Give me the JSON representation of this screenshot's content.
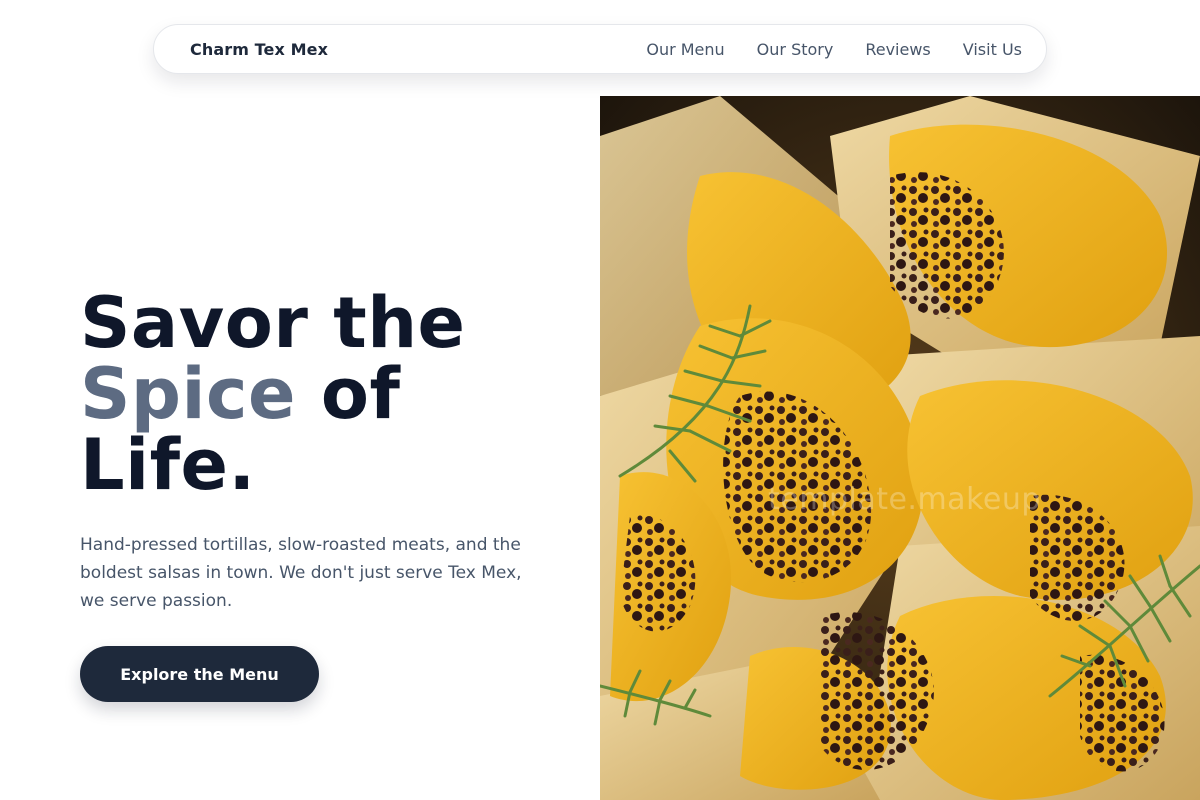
{
  "nav": {
    "brand": "Charm Tex Mex",
    "links": [
      "Our Menu",
      "Our Story",
      "Reviews",
      "Visit Us"
    ]
  },
  "hero": {
    "headline_line1": "Savor the",
    "headline_accent": "Spice",
    "headline_line2_rest": " of",
    "headline_line3": "Life.",
    "description": "Hand-pressed tortillas, slow-roasted meats, and the boldest salsas in town. We don't just serve Tex Mex, we serve passion.",
    "cta_label": "Explore the Menu",
    "image_watermark": "template.makeup"
  },
  "colors": {
    "primary_dark": "#1e293b",
    "heading": "#0f172a",
    "accent_text": "#5d6b82",
    "body_text": "#475569",
    "nav_text": "#475569"
  }
}
